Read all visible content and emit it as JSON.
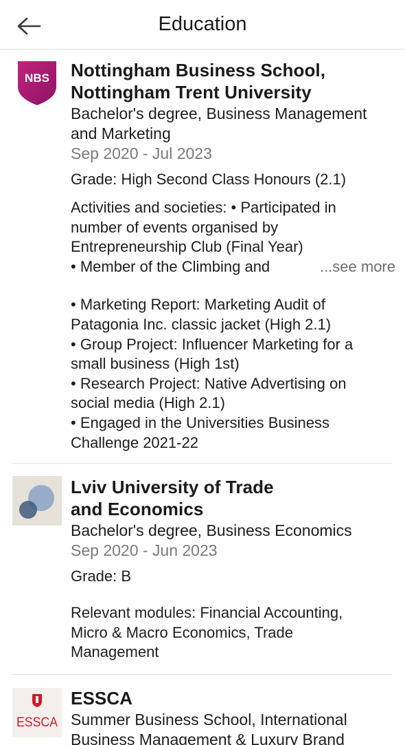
{
  "header": {
    "title": "Education",
    "back_icon": "arrow-left-icon"
  },
  "entries": [
    {
      "logo": {
        "text": "NBS",
        "color": "#b0176e",
        "icon": "nbs-shield-logo"
      },
      "school_line1": "Nottingham Business School,",
      "school_line2": "Nottingham Trent University",
      "degree_line1": "Bachelor's degree, Business Management",
      "degree_line2": "and Marketing",
      "dates": "Sep 2020 - Jul 2023",
      "grade": "Grade: High Second Class Honours (2.1)",
      "activities": [
        "Activities and societies: • Participated in",
        "number of events organised by",
        "Entrepreneurship Club (Final Year)",
        "• Member of the Climbing and"
      ],
      "see_more": "...see more",
      "description": [
        "• Marketing Report: Marketing Audit of",
        "Patagonia Inc. classic jacket (High 2.1)",
        "• Group Project: Influencer Marketing for a",
        "small business (High 1st)",
        "• Research Project: Native Advertising on",
        "social media (High 2.1)",
        "• Engaged in the Universities Business",
        "Challenge 2021-22"
      ]
    },
    {
      "logo": {
        "icon": "overlapping-circles-logo",
        "bg": "#e6e2d9"
      },
      "school_line1": "Lviv University of Trade",
      "school_line2": "and Economics",
      "degree_line1": "Bachelor's degree, Business Economics",
      "dates": "Sep 2020 - Jun 2023",
      "grade": "Grade: B",
      "description": [
        "Relevant modules: Financial Accounting,",
        "Micro & Macro Economics, Trade",
        "Management"
      ]
    },
    {
      "logo": {
        "text": "ESSCA",
        "color": "#d4192c",
        "icon": "essca-logo"
      },
      "school_line1": "ESSCA",
      "degree_line1": "Summer Business School, International",
      "degree_line2": "Business Management & Luxury Brand"
    }
  ]
}
